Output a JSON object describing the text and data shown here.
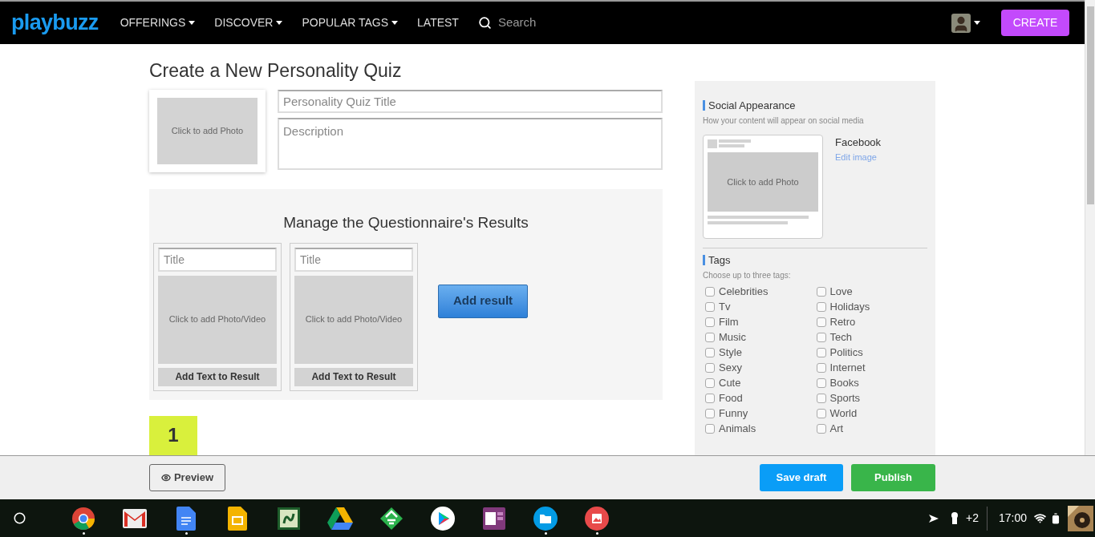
{
  "nav": {
    "logo": "playbuzz",
    "menu": [
      {
        "label": "OFFERINGS",
        "dropdown": true
      },
      {
        "label": "DISCOVER",
        "dropdown": true
      },
      {
        "label": "POPULAR TAGS",
        "dropdown": true
      },
      {
        "label": "LATEST",
        "dropdown": false
      }
    ],
    "search": {
      "placeholder": "Search"
    },
    "create": "CREATE"
  },
  "page": {
    "title": "Create a New Personality Quiz",
    "cover_photo": "Click to add Photo",
    "title_field": {
      "placeholder": "Personality Quiz Title"
    },
    "description_field": {
      "placeholder": "Description"
    }
  },
  "results": {
    "heading": "Manage the Questionnaire's Results",
    "cards": [
      {
        "title_placeholder": "Title",
        "media": "Click to add Photo/Video",
        "text_button": "Add Text to Result"
      },
      {
        "title_placeholder": "Title",
        "media": "Click to add Photo/Video",
        "text_button": "Add Text to Result"
      }
    ],
    "add_button": "Add result"
  },
  "question_number": "1",
  "social": {
    "heading": "Social Appearance",
    "subtitle": "How your content will appear on social media",
    "preview_photo": "Click to add Photo",
    "network": "Facebook",
    "edit_link": "Edit image"
  },
  "tags": {
    "heading": "Tags",
    "subtitle": "Choose up to three tags:",
    "items": [
      {
        "label": "Celebrities",
        "checked": false
      },
      {
        "label": "Tv",
        "checked": false
      },
      {
        "label": "Film",
        "checked": false
      },
      {
        "label": "Music",
        "checked": false
      },
      {
        "label": "Style",
        "checked": false
      },
      {
        "label": "Sexy",
        "checked": false
      },
      {
        "label": "Cute",
        "checked": false
      },
      {
        "label": "Food",
        "checked": false
      },
      {
        "label": "Funny",
        "checked": false
      },
      {
        "label": "Animals",
        "checked": false
      },
      {
        "label": "Love",
        "checked": false
      },
      {
        "label": "Holidays",
        "checked": false
      },
      {
        "label": "Retro",
        "checked": false
      },
      {
        "label": "Tech",
        "checked": false
      },
      {
        "label": "Politics",
        "checked": false
      },
      {
        "label": "Internet",
        "checked": false
      },
      {
        "label": "Books",
        "checked": false
      },
      {
        "label": "Sports",
        "checked": false
      },
      {
        "label": "World",
        "checked": false
      },
      {
        "label": "Art",
        "checked": false
      }
    ]
  },
  "actions": {
    "preview": "Preview",
    "save": "Save draft",
    "publish": "Publish"
  },
  "shelf": [
    {
      "kind": "chrome",
      "running": true
    },
    {
      "kind": "mail",
      "running": false
    },
    {
      "kind": "docs",
      "running": true
    },
    {
      "kind": "slides",
      "running": false
    },
    {
      "kind": "sway",
      "running": false
    },
    {
      "kind": "drive",
      "running": false
    },
    {
      "kind": "feedly",
      "running": false
    },
    {
      "kind": "play",
      "running": false
    },
    {
      "kind": "onenote",
      "running": false
    },
    {
      "kind": "files",
      "running": true
    },
    {
      "kind": "photos",
      "running": true
    }
  ],
  "tray": {
    "notifications": "+2",
    "time": "17:00"
  }
}
